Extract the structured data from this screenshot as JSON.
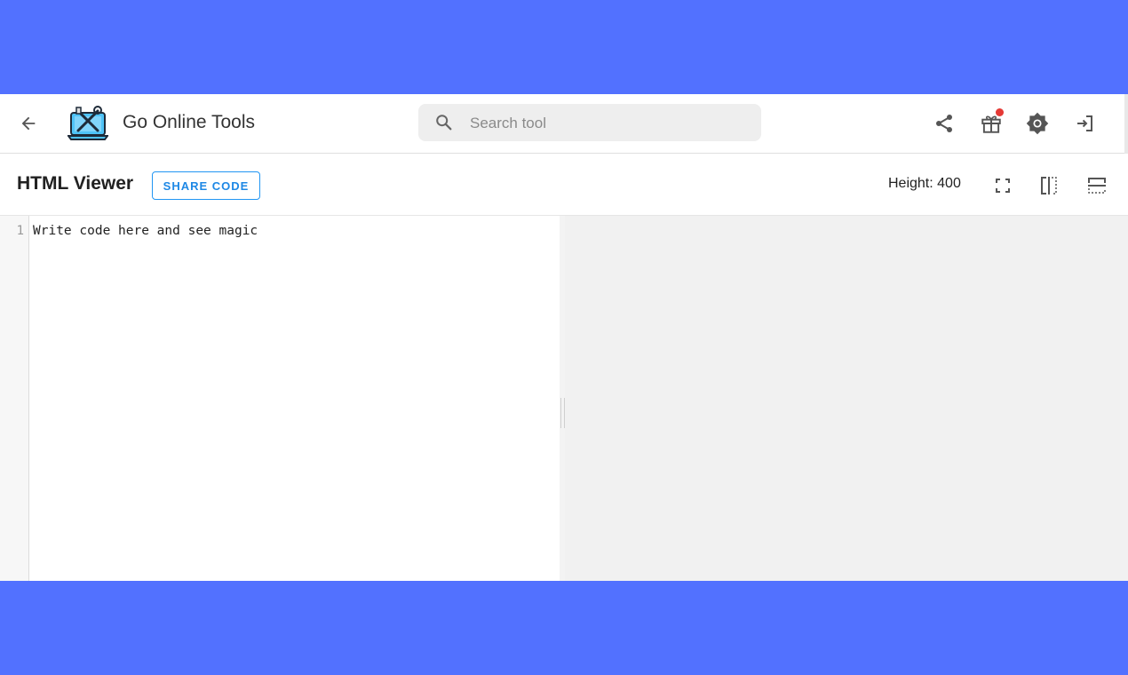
{
  "header": {
    "app_title": "Go Online Tools",
    "search_placeholder": "Search tool",
    "icons": [
      "back-arrow-icon",
      "search-icon",
      "share-icon",
      "gift-icon",
      "theme-icon",
      "login-icon"
    ],
    "gift_has_notification": true
  },
  "toolbar": {
    "title": "HTML Viewer",
    "share_code_label": "SHARE CODE",
    "height_label": "Height:",
    "height_value": "400",
    "icons": [
      "fullscreen-icon",
      "split-vertical-icon",
      "split-horizontal-icon"
    ]
  },
  "editor": {
    "line_number": "1",
    "content": "Write code here and see magic"
  },
  "colors": {
    "background": "#5271ff",
    "accent": "#1e88e5",
    "notification": "#e53935"
  }
}
